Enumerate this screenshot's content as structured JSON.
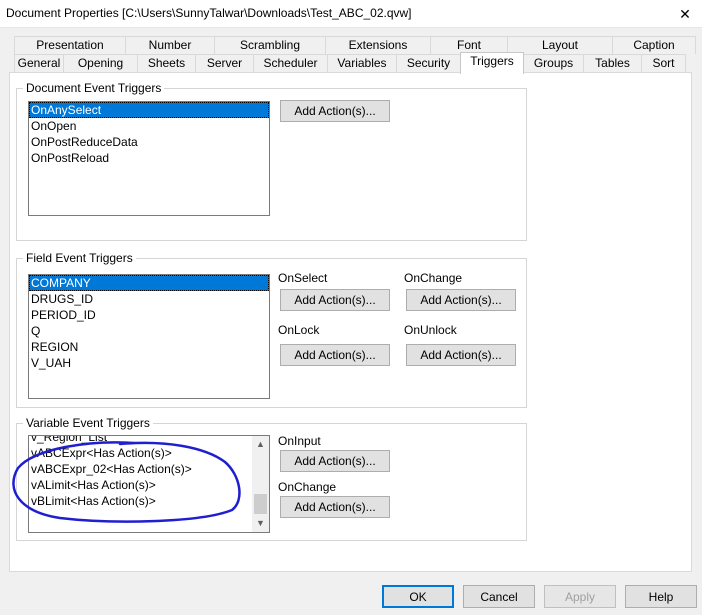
{
  "window": {
    "title": "Document Properties [C:\\Users\\SunnyTalwar\\Downloads\\Test_ABC_02.qvw]",
    "close_glyph": "✕"
  },
  "tabs_row1": [
    "Presentation",
    "Number",
    "Scrambling",
    "Extensions",
    "Font",
    "Layout",
    "Caption"
  ],
  "tabs_row2": [
    "General",
    "Opening",
    "Sheets",
    "Server",
    "Scheduler",
    "Variables",
    "Security",
    "Triggers",
    "Groups",
    "Tables",
    "Sort"
  ],
  "active_tab": "Triggers",
  "document_triggers": {
    "label": "Document Event Triggers",
    "items": [
      "OnAnySelect",
      "OnOpen",
      "OnPostReduceData",
      "OnPostReload"
    ],
    "selected_index": 0,
    "add_button": "Add Action(s)..."
  },
  "field_triggers": {
    "label": "Field Event Triggers",
    "items": [
      "COMPANY",
      "DRUGS_ID",
      "PERIOD_ID",
      "Q",
      "REGION",
      "V_UAH"
    ],
    "selected_index": 0,
    "on_select_label": "OnSelect",
    "on_change_label": "OnChange",
    "on_lock_label": "OnLock",
    "on_unlock_label": "OnUnlock",
    "add_button": "Add Action(s)..."
  },
  "variable_triggers": {
    "label": "Variable Event Triggers",
    "items": [
      "v_Region_List",
      "vABCExpr<Has Action(s)>",
      "vABCExpr_02<Has Action(s)>",
      "vALimit<Has Action(s)>",
      "vBLimit<Has Action(s)>"
    ],
    "on_input_label": "OnInput",
    "on_change_label": "OnChange",
    "add_button": "Add Action(s)...",
    "annotation_color": "#1f1fd0"
  },
  "footer": {
    "ok": "OK",
    "cancel": "Cancel",
    "apply": "Apply",
    "help": "Help"
  },
  "colors": {
    "selection": "#0078d7",
    "default_button_border": "#0078d7"
  }
}
